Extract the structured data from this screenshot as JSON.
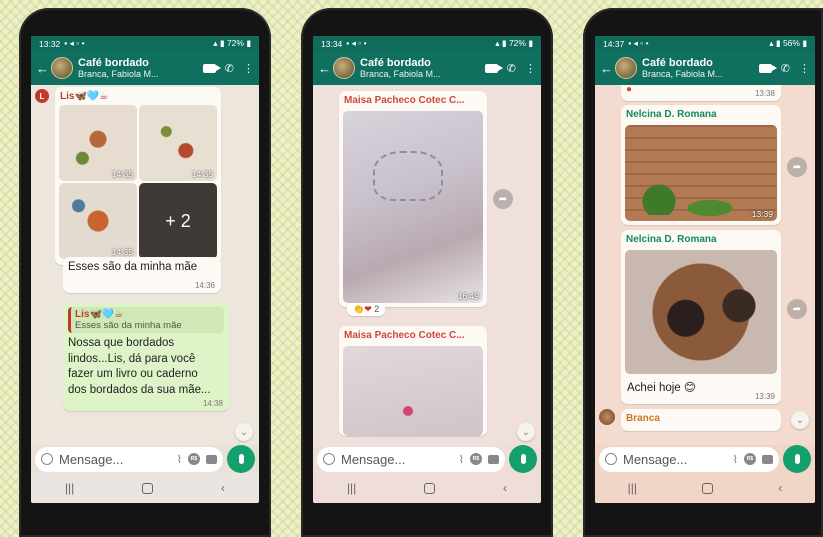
{
  "chat": {
    "title": "Café bordado",
    "subtitle": "Branca, Fabiola M...",
    "placeholder": "Mensage..."
  },
  "colors": {
    "header": "#107060",
    "accent": "#14a06c"
  },
  "phones": [
    {
      "status_time": "13:32",
      "status_battery": "72%",
      "messages": {
        "lis_sender": "Lis🦋🩵☕",
        "avatar_letter": "L",
        "img_times": [
          "14:35",
          "14:35",
          "14:35"
        ],
        "more_count": "+ 2",
        "caption": "Esses são da minha mãe",
        "caption_time": "14:36",
        "quote_sender": "Lis🦋🩵☕",
        "quote_text": "Esses são da minha mãe",
        "reply_text": "Nossa que bordados lindos...Lis, dá para você fazer um livro ou caderno dos bordados da sua mãe...",
        "reply_time": "14:38"
      }
    },
    {
      "status_time": "13:34",
      "status_battery": "72%",
      "messages": {
        "sender1": "Maisa Pacheco Cotec C...",
        "img1_time": "16:49",
        "reaction_count": "2",
        "sender2": "Maisa Pacheco Cotec C..."
      }
    },
    {
      "status_time": "14:37",
      "status_battery": "56%",
      "messages": {
        "top_time": "13:38",
        "sender1": "Nelcina D. Romana",
        "img1_time": "13:39",
        "sender2": "Nelcina D. Romana",
        "caption": "Achei hoje 😊",
        "caption_time": "13:39",
        "sender3": "Branca"
      }
    }
  ]
}
